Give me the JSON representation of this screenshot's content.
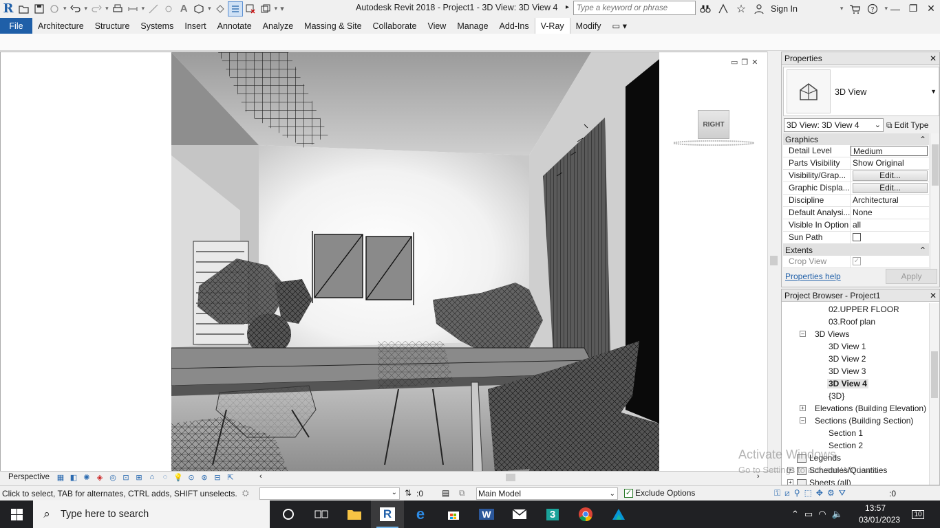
{
  "titlebar": {
    "title": "Autodesk Revit 2018 -    Project1 - 3D View: 3D View 4",
    "search_placeholder": "Type a keyword or phrase",
    "sign_in": "Sign In"
  },
  "ribbon": {
    "tabs": [
      "File",
      "Architecture",
      "Structure",
      "Systems",
      "Insert",
      "Annotate",
      "Analyze",
      "Massing & Site",
      "Collaborate",
      "View",
      "Manage",
      "Add-Ins",
      "V-Ray",
      "Modify"
    ],
    "active_tab": "V-Ray",
    "file_color": "#1f5fa8"
  },
  "viewport": {
    "viewcube_label": "RIGHT",
    "scale_label": "Perspective"
  },
  "properties": {
    "title": "Properties",
    "type_name": "3D View",
    "view_selector": "3D View: 3D View 4",
    "edit_type": "Edit Type",
    "groups": {
      "graphics": "Graphics",
      "extents": "Extents"
    },
    "rows": [
      {
        "key": "Detail Level",
        "value": "Medium"
      },
      {
        "key": "Parts Visibility",
        "value": "Show Original"
      },
      {
        "key": "Visibility/Grap...",
        "value": "Edit..."
      },
      {
        "key": "Graphic Displa...",
        "value": "Edit..."
      },
      {
        "key": "Discipline",
        "value": "Architectural"
      },
      {
        "key": "Default Analysi...",
        "value": "None"
      },
      {
        "key": "Visible In Option",
        "value": "all"
      },
      {
        "key": "Sun Path",
        "value": ""
      }
    ],
    "crop_view": "Crop View",
    "help": "Properties help",
    "apply": "Apply"
  },
  "browser": {
    "title": "Project Browser - Project1",
    "items": [
      "02.UPPER FLOOR",
      "03.Roof plan",
      "3D Views",
      "3D View 1",
      "3D View 2",
      "3D View 3",
      "3D View 4",
      "{3D}",
      "Elevations (Building Elevation)",
      "Sections (Building Section)",
      "Section 1",
      "Section 2",
      "Legends",
      "Schedules/Quantities",
      "Sheets (all)"
    ],
    "selected": "3D View 4"
  },
  "watermark": {
    "line1": "Activate Windows",
    "line2": "Go to Settings to activate Windows."
  },
  "statusbar": {
    "message": "Click to select, TAB for alternates, CTRL adds, SHIFT unselects.",
    "selection_count": ":0",
    "model": "Main Model",
    "exclude_options": "Exclude Options",
    "filter_count": ":0"
  },
  "taskbar": {
    "search_placeholder": "Type here to search",
    "time": "13:57",
    "date": "03/01/2023",
    "notifications": "10"
  }
}
